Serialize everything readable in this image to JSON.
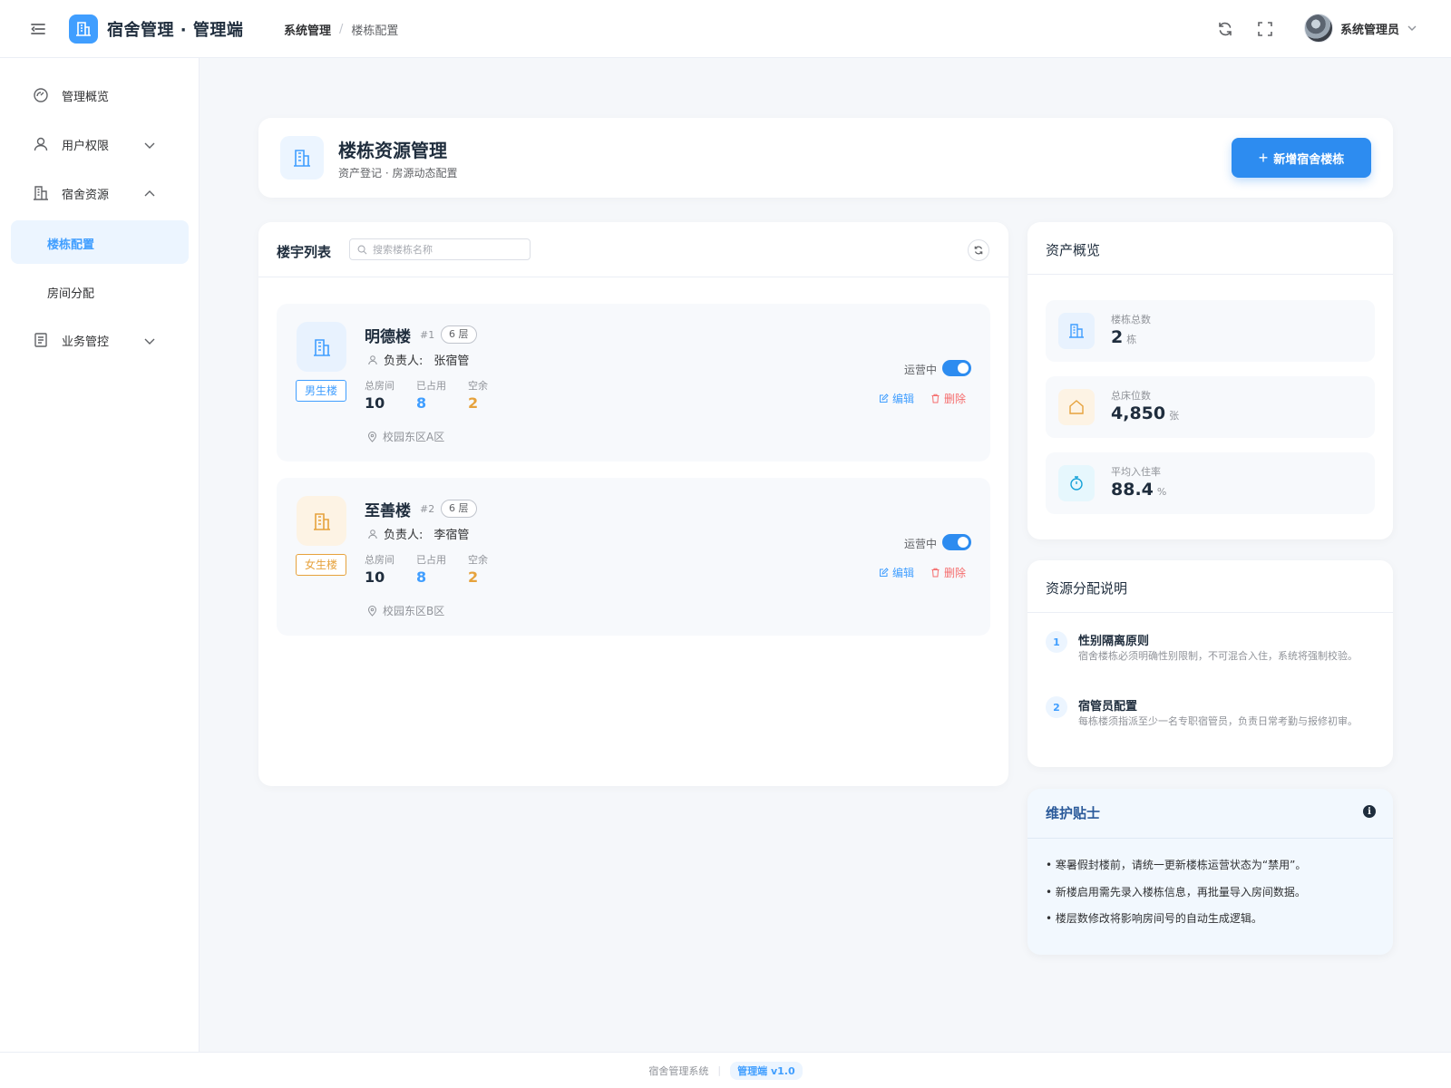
{
  "header": {
    "brand": "宿舍管理 · 管理端",
    "breadcrumb": [
      "系统管理",
      "楼栋配置"
    ],
    "user_name": "系统管理员"
  },
  "sidebar": {
    "items": [
      {
        "label": "管理概览",
        "icon": "dashboard-icon"
      },
      {
        "label": "用户权限",
        "icon": "user-icon"
      },
      {
        "label": "宿舍资源",
        "icon": "building-icon"
      },
      {
        "label": "楼栋配置",
        "active": true
      },
      {
        "label": "房间分配"
      },
      {
        "label": "业务管控",
        "icon": "document-icon"
      }
    ]
  },
  "page": {
    "title": "楼栋资源管理",
    "subtitle": "资产登记 · 房源动态配置",
    "add_button": "新增宿舍楼栋"
  },
  "list": {
    "title": "楼宇列表",
    "search_placeholder": "搜索楼栋名称",
    "buildings": [
      {
        "name": "明德楼",
        "no": "#1",
        "floors": "6 层",
        "tag": "男生楼",
        "manager_label": "负责人:",
        "manager": "张宿管",
        "total_label": "总房间",
        "total": "10",
        "used_label": "已占用",
        "used": "8",
        "free_label": "空余",
        "free": "2",
        "location": "校园东区A区",
        "status": "运营中",
        "enabled": true,
        "edit": "编辑",
        "delete": "删除"
      },
      {
        "name": "至善楼",
        "no": "#2",
        "floors": "6 层",
        "tag": "女生楼",
        "manager_label": "负责人:",
        "manager": "李宿管",
        "total_label": "总房间",
        "total": "10",
        "used_label": "已占用",
        "used": "8",
        "free_label": "空余",
        "free": "2",
        "location": "校园东区B区",
        "status": "运营中",
        "enabled": true,
        "edit": "编辑",
        "delete": "删除"
      }
    ]
  },
  "overview": {
    "title": "资产概览",
    "items": [
      {
        "label": "楼栋总数",
        "value": "2",
        "unit": "栋"
      },
      {
        "label": "总床位数",
        "value": "4,850",
        "unit": "张"
      },
      {
        "label": "平均入住率",
        "value": "88.4",
        "unit": "%"
      }
    ]
  },
  "rules": {
    "title": "资源分配说明",
    "items": [
      {
        "num": "1",
        "title": "性别隔离原则",
        "desc": "宿舍楼栋必须明确性别限制，不可混合入住，系统将强制校验。"
      },
      {
        "num": "2",
        "title": "宿管员配置",
        "desc": "每栋楼须指派至少一名专职宿管员，负责日常考勤与报修初审。"
      }
    ]
  },
  "tips": {
    "title": "维护贴士",
    "items": [
      "• 寒暑假封楼前，请统一更新楼栋运营状态为“禁用”。",
      "• 新楼启用需先录入楼栋信息，再批量导入房间数据。",
      "• 楼层数修改将影响房间号的自动生成逻辑。"
    ]
  },
  "footer": {
    "system": "宿舍管理系统",
    "version": "管理端 v1.0"
  },
  "colors": {
    "primary": "#409eff",
    "button": "#2d8cf0",
    "male": "#409eff",
    "female": "#e6a23c",
    "danger": "#f56c6c"
  }
}
